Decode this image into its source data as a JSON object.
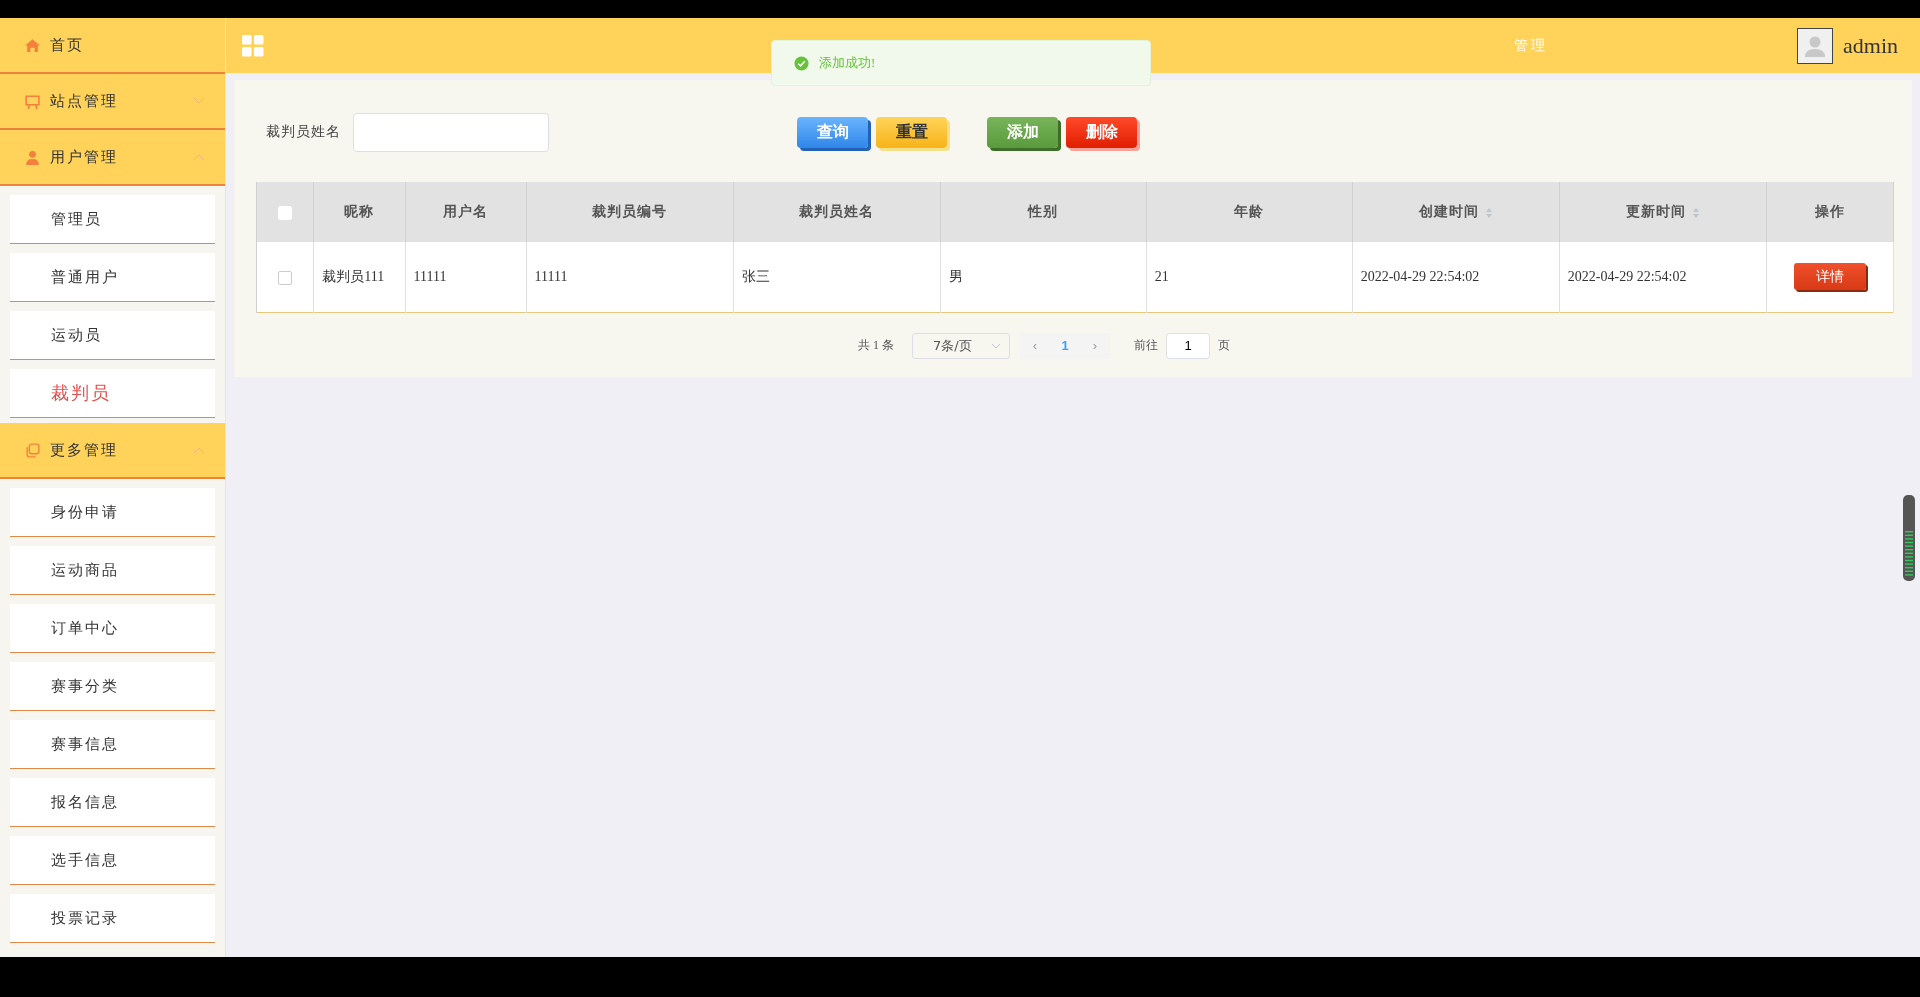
{
  "sidebar": {
    "items": [
      {
        "kind": "link",
        "label": "首页"
      },
      {
        "kind": "group",
        "label": "站点管理",
        "expanded": false
      },
      {
        "kind": "group",
        "label": "用户管理",
        "expanded": true,
        "children": [
          {
            "label": "管理员",
            "selected": false
          },
          {
            "label": "普通用户",
            "selected": false
          },
          {
            "label": "运动员",
            "selected": false
          },
          {
            "label": "裁判员",
            "selected": true
          }
        ]
      },
      {
        "kind": "group",
        "label": "更多管理",
        "expanded": true,
        "children": [
          {
            "label": "身份申请",
            "selected": false
          },
          {
            "label": "运动商品",
            "selected": false
          },
          {
            "label": "订单中心",
            "selected": false
          },
          {
            "label": "赛事分类",
            "selected": false
          },
          {
            "label": "赛事信息",
            "selected": false
          },
          {
            "label": "报名信息",
            "selected": false
          },
          {
            "label": "选手信息",
            "selected": false
          },
          {
            "label": "投票记录",
            "selected": false
          }
        ]
      }
    ]
  },
  "header": {
    "title": "管理",
    "user": "admin"
  },
  "toast": {
    "message": "添加成功!"
  },
  "search": {
    "label": "裁判员姓名"
  },
  "buttons": [
    {
      "kind": "blue",
      "label": "查询"
    },
    {
      "kind": "yellow",
      "label": "重置"
    },
    {
      "kind": "green",
      "label": "添加"
    },
    {
      "kind": "red",
      "label": "删除"
    }
  ],
  "table": {
    "select_all_checked": false,
    "columns": [
      {
        "label": "昵称",
        "sortable": false
      },
      {
        "label": "用户名",
        "sortable": false
      },
      {
        "label": "裁判员编号",
        "sortable": false
      },
      {
        "label": "裁判员姓名",
        "sortable": false
      },
      {
        "label": "性别",
        "sortable": false
      },
      {
        "label": "年龄",
        "sortable": false
      },
      {
        "label": "创建时间",
        "sortable": true
      },
      {
        "label": "更新时间",
        "sortable": true
      },
      {
        "label": "操作",
        "sortable": false
      }
    ],
    "rows": [
      {
        "checked": false,
        "cells": [
          "裁判员111",
          "11111",
          "11111",
          "张三",
          "男",
          "21",
          "2022-04-29 22:54:02",
          "2022-04-29 22:54:02"
        ],
        "action": "详情"
      }
    ]
  },
  "pagination": {
    "total": "共 1 条",
    "page_size": "7条/页",
    "prev": "‹",
    "pages": [
      {
        "label": "1",
        "selected": true
      }
    ],
    "next": "›",
    "goto_label": "前往",
    "goto_value": "1",
    "goto_suffix": "页"
  }
}
